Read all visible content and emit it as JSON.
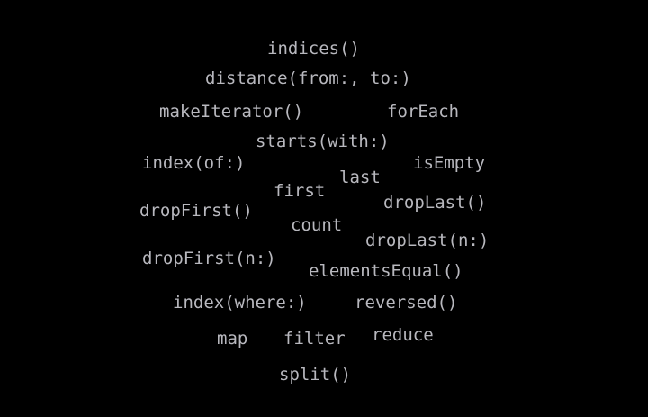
{
  "background_color": "#000000",
  "text_color": "#b8b8be",
  "terms": {
    "indices": "indices()",
    "distance": "distance(from:, to:)",
    "make_iterator": "makeIterator()",
    "for_each": "forEach",
    "starts_with": "starts(with:)",
    "index_of": "index(of:)",
    "is_empty": "isEmpty",
    "last": "last",
    "first": "first",
    "drop_last": "dropLast()",
    "drop_first": "dropFirst()",
    "count": "count",
    "drop_last_n": "dropLast(n:)",
    "drop_first_n": "dropFirst(n:)",
    "elements_equal": "elementsEqual()",
    "index_where": "index(where:)",
    "reversed": "reversed()",
    "map": "map",
    "filter": "filter",
    "reduce": "reduce",
    "split": "split()"
  }
}
